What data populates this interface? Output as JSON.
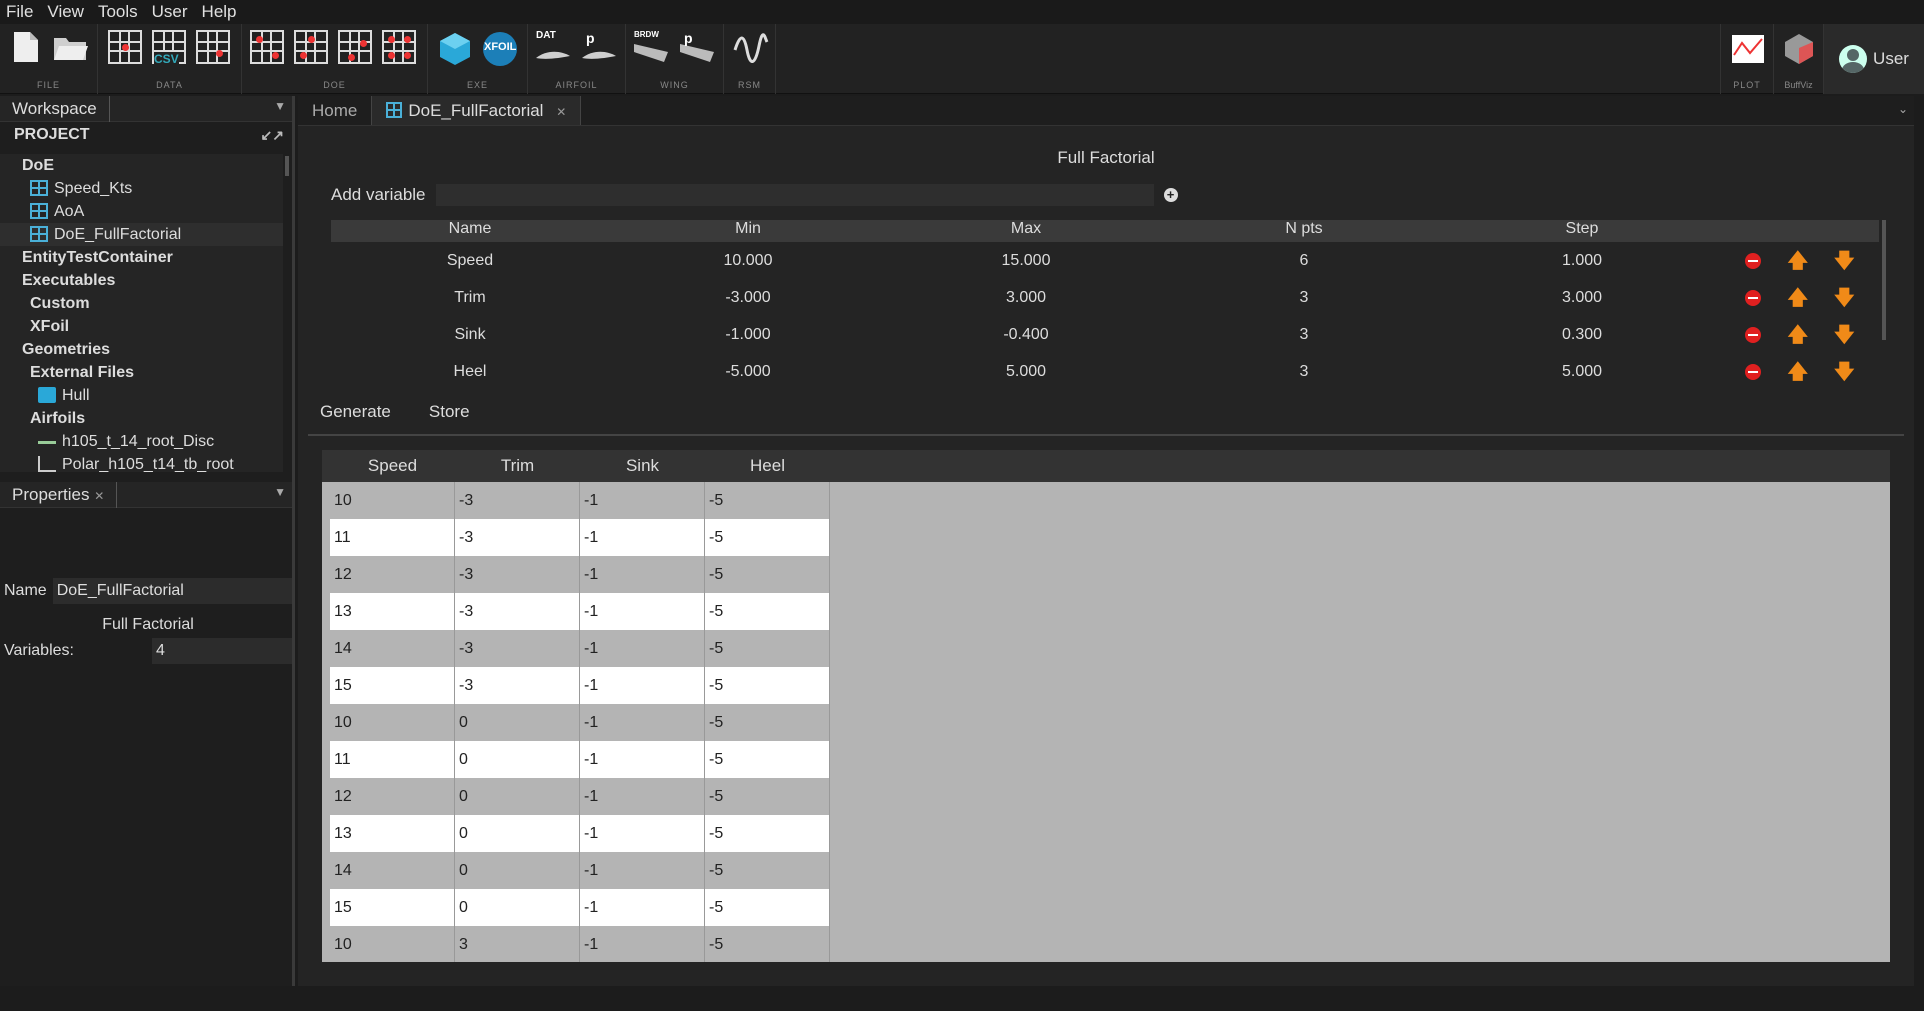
{
  "menu": [
    "File",
    "View",
    "Tools",
    "User",
    "Help"
  ],
  "toolbar": {
    "groups": [
      "FILE",
      "DATA",
      "DOE",
      "EXE",
      "AIRFOIL",
      "WING",
      "RSM",
      "PLOT",
      "BuffViz"
    ],
    "user": "User",
    "exe_xfoil": "XFOIL",
    "data_csv": "CSV",
    "airfoil_dat": "DAT",
    "airfoil_p": "p",
    "wing_brdw": "BRDW",
    "wing_p": "p"
  },
  "left": {
    "workspace_tab": "Workspace",
    "project_label": "PROJECT",
    "tree": [
      {
        "label": "DoE",
        "bold": true,
        "indent": 0,
        "icon": ""
      },
      {
        "label": "Speed_Kts",
        "bold": false,
        "indent": 1,
        "icon": "doe"
      },
      {
        "label": "AoA",
        "bold": false,
        "indent": 1,
        "icon": "doe"
      },
      {
        "label": "DoE_FullFactorial",
        "bold": false,
        "indent": 1,
        "icon": "doe"
      },
      {
        "label": "EntityTestContainer",
        "bold": true,
        "indent": 0,
        "icon": ""
      },
      {
        "label": "Executables",
        "bold": true,
        "indent": 0,
        "icon": ""
      },
      {
        "label": "Custom",
        "bold": true,
        "indent": 1,
        "icon": ""
      },
      {
        "label": "XFoil",
        "bold": true,
        "indent": 1,
        "icon": ""
      },
      {
        "label": "Geometries",
        "bold": true,
        "indent": 0,
        "icon": ""
      },
      {
        "label": "External Files",
        "bold": true,
        "indent": 1,
        "icon": ""
      },
      {
        "label": "Hull",
        "bold": false,
        "indent": 2,
        "icon": "obj"
      },
      {
        "label": "Airfoils",
        "bold": true,
        "indent": 1,
        "icon": ""
      },
      {
        "label": "h105_t_14_root_Disc",
        "bold": false,
        "indent": 2,
        "icon": "airfoil"
      },
      {
        "label": "Polar_h105_t14_tb_root",
        "bold": false,
        "indent": 2,
        "icon": "polar"
      }
    ],
    "properties_tab": "Properties",
    "name_label": "Name",
    "name_value": "DoE_FullFactorial",
    "section_title": "Full Factorial",
    "variables_label": "Variables:",
    "variables_value": "4"
  },
  "main": {
    "tabs": [
      "Home",
      "DoE_FullFactorial"
    ],
    "title": "Full Factorial",
    "add_variable": "Add variable",
    "columns": [
      "Name",
      "Min",
      "Max",
      "N pts",
      "Step"
    ],
    "variables": [
      {
        "name": "Speed",
        "min": "10.000",
        "max": "15.000",
        "npts": "6",
        "step": "1.000"
      },
      {
        "name": "Trim",
        "min": "-3.000",
        "max": "3.000",
        "npts": "3",
        "step": "3.000"
      },
      {
        "name": "Sink",
        "min": "-1.000",
        "max": "-0.400",
        "npts": "3",
        "step": "0.300"
      },
      {
        "name": "Heel",
        "min": "-5.000",
        "max": "5.000",
        "npts": "3",
        "step": "5.000"
      }
    ],
    "generate": "Generate",
    "store": "Store",
    "grid_columns": [
      "Speed",
      "Trim",
      "Sink",
      "Heel"
    ],
    "grid_rows": [
      [
        "10",
        "-3",
        "-1",
        "-5"
      ],
      [
        "11",
        "-3",
        "-1",
        "-5"
      ],
      [
        "12",
        "-3",
        "-1",
        "-5"
      ],
      [
        "13",
        "-3",
        "-1",
        "-5"
      ],
      [
        "14",
        "-3",
        "-1",
        "-5"
      ],
      [
        "15",
        "-3",
        "-1",
        "-5"
      ],
      [
        "10",
        "0",
        "-1",
        "-5"
      ],
      [
        "11",
        "0",
        "-1",
        "-5"
      ],
      [
        "12",
        "0",
        "-1",
        "-5"
      ],
      [
        "13",
        "0",
        "-1",
        "-5"
      ],
      [
        "14",
        "0",
        "-1",
        "-5"
      ],
      [
        "15",
        "0",
        "-1",
        "-5"
      ],
      [
        "10",
        "3",
        "-1",
        "-5"
      ]
    ]
  }
}
